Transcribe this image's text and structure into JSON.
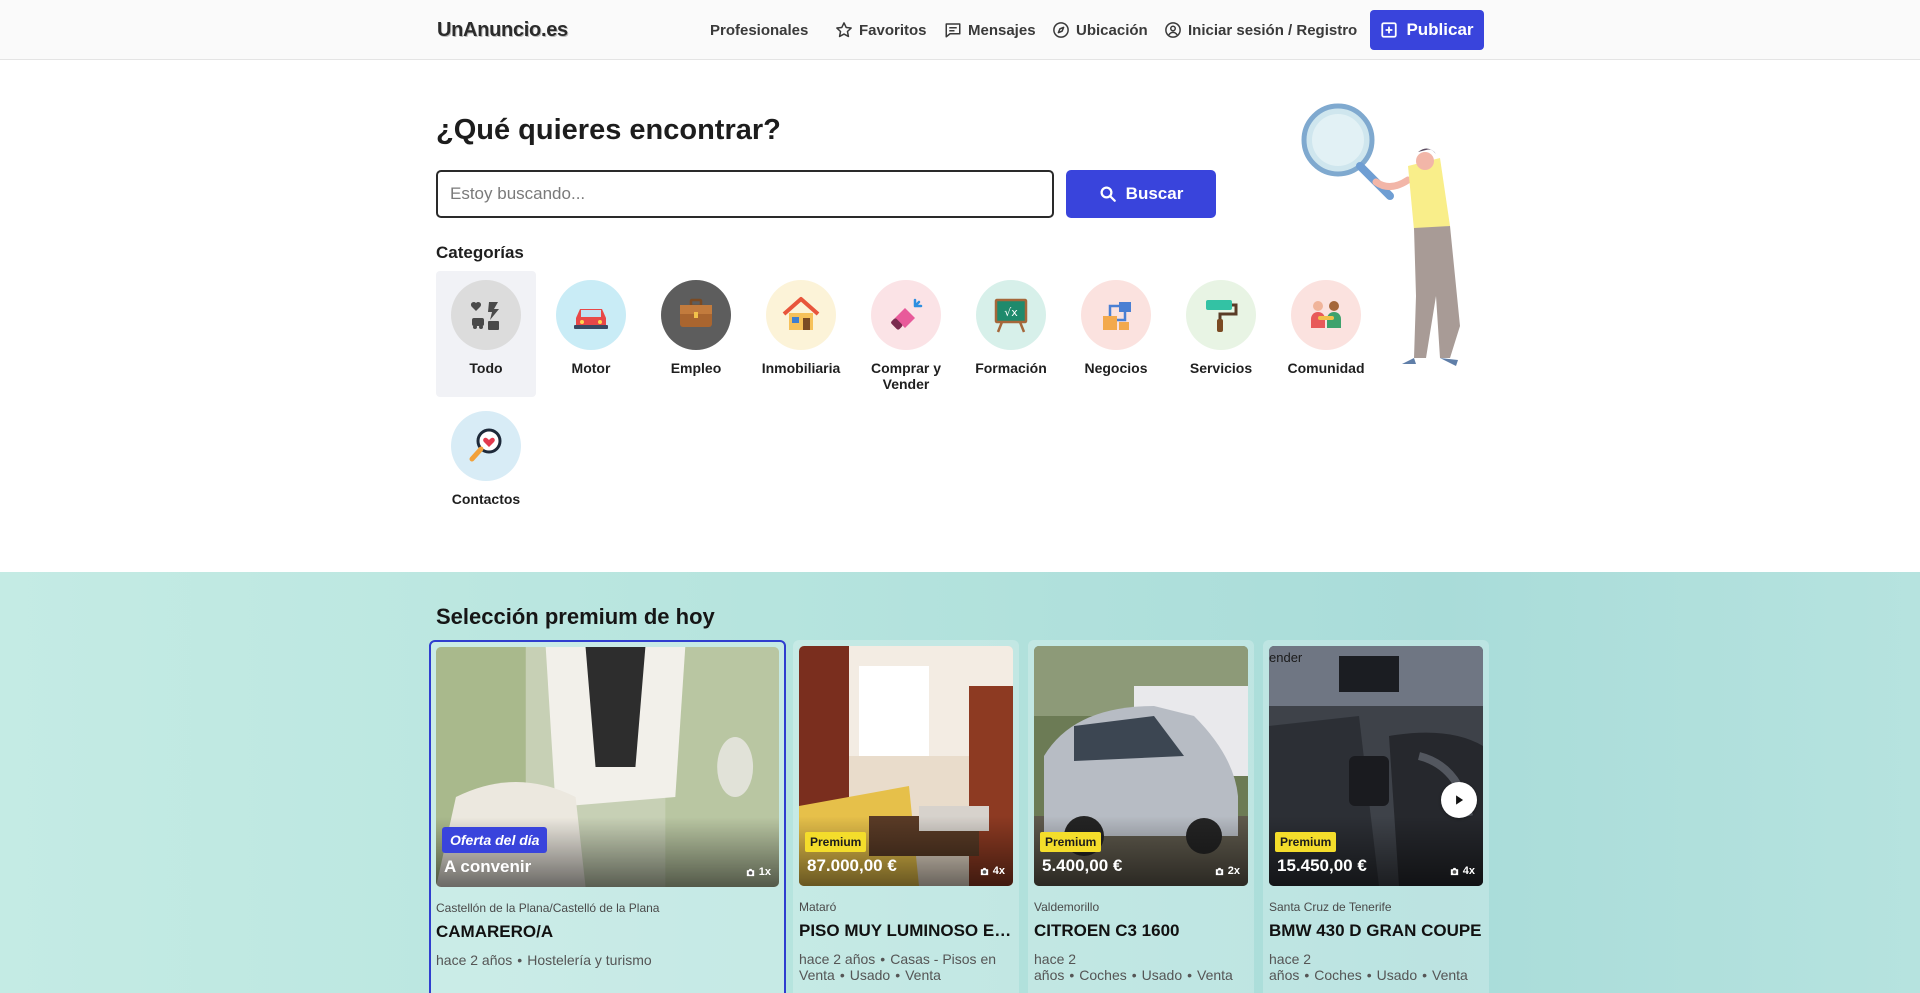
{
  "header": {
    "logo": "UnAnuncio.es",
    "nav": {
      "profesionales": "Profesionales",
      "favoritos": "Favoritos",
      "mensajes": "Mensajes",
      "ubicacion": "Ubicación",
      "login": "Iniciar sesión / Registro"
    },
    "publish_label": "Publicar"
  },
  "hero": {
    "title": "¿Qué quieres encontrar?",
    "search_placeholder": "Estoy buscando...",
    "search_button": "Buscar"
  },
  "categories": {
    "heading": "Categorías",
    "items": [
      {
        "label": "Todo",
        "icon": "all-categories-icon",
        "active": true
      },
      {
        "label": "Motor",
        "icon": "car-icon"
      },
      {
        "label": "Empleo",
        "icon": "briefcase-icon"
      },
      {
        "label": "Inmobiliaria",
        "icon": "house-icon"
      },
      {
        "label": "Comprar y Vender",
        "icon": "tag-icon"
      },
      {
        "label": "Formación",
        "icon": "chalkboard-icon"
      },
      {
        "label": "Negocios",
        "icon": "business-boxes-icon"
      },
      {
        "label": "Servicios",
        "icon": "paint-roller-icon"
      },
      {
        "label": "Comunidad",
        "icon": "community-icon"
      },
      {
        "label": "Contactos",
        "icon": "heart-magnifier-icon"
      }
    ]
  },
  "premium": {
    "title": "Selección premium de hoy",
    "cards": [
      {
        "badge": "Oferta del día",
        "price": "A convenir",
        "photos": "1x",
        "location": "Castellón de la Plana/Castelló de la Plana",
        "title": "CAMARERO/A",
        "meta": [
          "hace 2 años",
          "Hostelería y turismo"
        ]
      },
      {
        "badge": "Premium",
        "price": "87.000,00 €",
        "photos": "4x",
        "location": "Mataró",
        "title": "PISO MUY LUMINOSO EN MATARÓ",
        "meta": [
          "hace 2 años",
          "Casas - Pisos en Venta",
          "Usado",
          "Venta"
        ]
      },
      {
        "badge": "Premium",
        "price": "5.400,00 €",
        "photos": "2x",
        "location": "Valdemorillo",
        "title": "CITROEN C3 1600",
        "meta": [
          "hace 2 años",
          "Coches",
          "Usado",
          "Venta"
        ]
      },
      {
        "badge": "Premium",
        "price": "15.450,00 €",
        "photos": "4x",
        "location": "Santa Cruz de Tenerife",
        "title": "BMW 430 D GRAN COUPE",
        "meta": [
          "hace 2 años",
          "Coches",
          "Usado",
          "Venta"
        ],
        "photo_caption": "ender"
      }
    ]
  },
  "colors": {
    "accent": "#3944dc",
    "premium_badge": "#f4dd2b",
    "section_bg": "#b6e4de"
  }
}
